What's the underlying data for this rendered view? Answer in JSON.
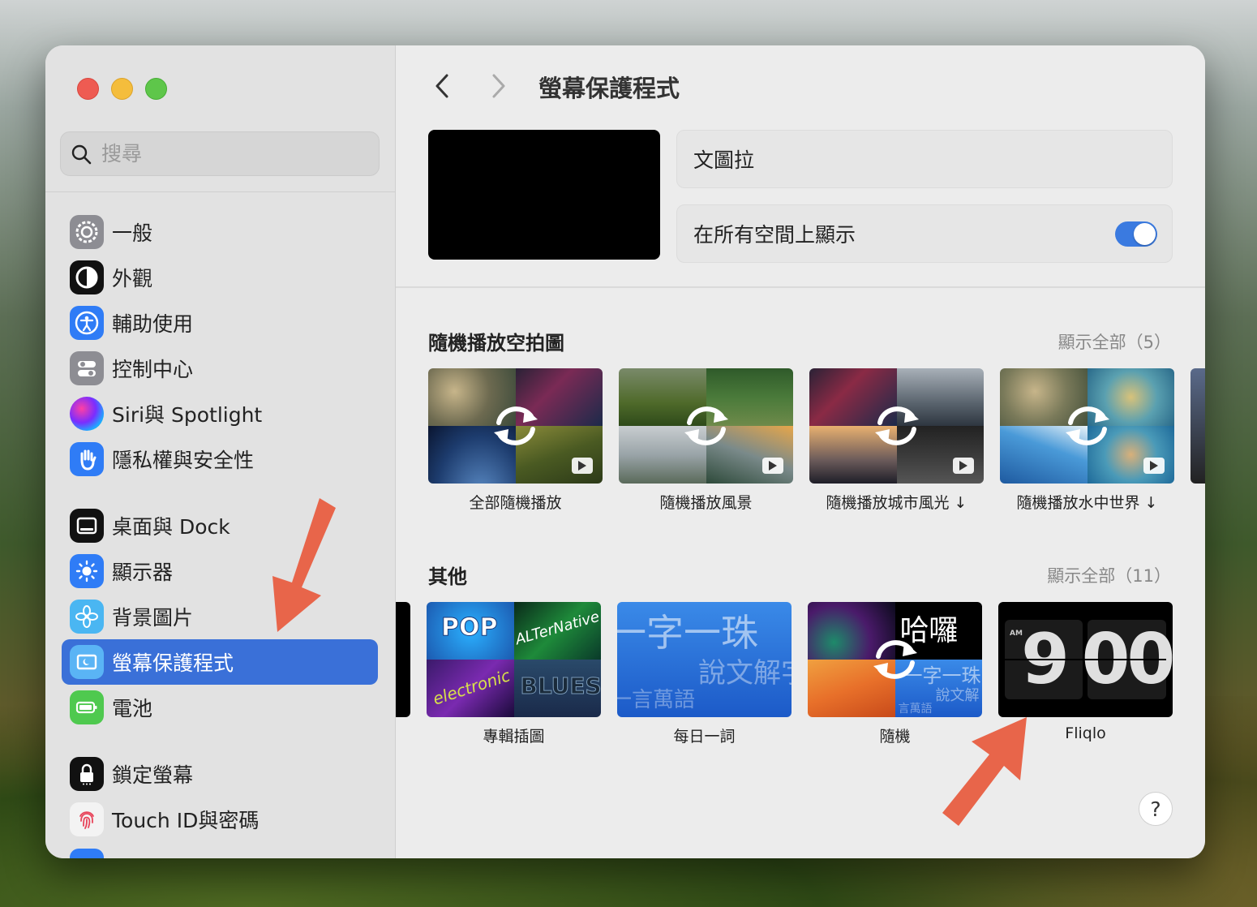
{
  "sidebar": {
    "search_placeholder": "搜尋",
    "items": [
      {
        "label": "一般",
        "icon": "gear-icon"
      },
      {
        "label": "外觀",
        "icon": "appearance-icon"
      },
      {
        "label": "輔助使用",
        "icon": "accessibility-icon"
      },
      {
        "label": "控制中心",
        "icon": "control-center-icon"
      },
      {
        "label": "Siri與 Spotlight",
        "icon": "siri-icon"
      },
      {
        "label": "隱私權與安全性",
        "icon": "privacy-hand-icon"
      },
      {
        "label": "桌面與 Dock",
        "icon": "dock-icon"
      },
      {
        "label": "顯示器",
        "icon": "display-brightness-icon"
      },
      {
        "label": "背景圖片",
        "icon": "wallpaper-flower-icon"
      },
      {
        "label": "螢幕保護程式",
        "icon": "screensaver-icon"
      },
      {
        "label": "電池",
        "icon": "battery-icon"
      },
      {
        "label": "鎖定螢幕",
        "icon": "lock-icon"
      },
      {
        "label": "Touch ID與密碼",
        "icon": "fingerprint-icon"
      }
    ],
    "selected_index": 9
  },
  "header": {
    "title": "螢幕保護程式"
  },
  "settings": {
    "selected_saver": "文圖拉",
    "show_all_spaces_label": "在所有空間上顯示",
    "show_all_spaces_on": true
  },
  "aerials": {
    "title": "隨機播放空拍圖",
    "show_all": "顯示全部（5）",
    "items": [
      {
        "label": "全部隨機播放"
      },
      {
        "label": "隨機播放風景"
      },
      {
        "label": "隨機播放城市風光 ↓"
      },
      {
        "label": "隨機播放水中世界 ↓"
      }
    ]
  },
  "others": {
    "title": "其他",
    "show_all": "顯示全部（11）",
    "items": [
      {
        "label": "專輯插圖"
      },
      {
        "label": "每日一詞"
      },
      {
        "label": "隨機"
      },
      {
        "label": "Fliqlo"
      }
    ],
    "word_of_day_text": "一字一珠",
    "word_of_day_sub": "說文解字",
    "word_of_day_sub2": "一言萬語",
    "random_text": "哈囉",
    "random_sub": "一字一珠",
    "random_sub2": "說文解",
    "random_sub3": "言萬語",
    "album_pop": "POP",
    "album_alt": "ALTerNative",
    "album_elec": "electronic",
    "album_blues": "BLUES",
    "fliqlo_ampm": "AM",
    "fliqlo_hour": "9",
    "fliqlo_min": "00"
  },
  "help_label": "?",
  "colors": {
    "accent": "#3a70d8",
    "annotation_arrow": "#e8654a"
  }
}
